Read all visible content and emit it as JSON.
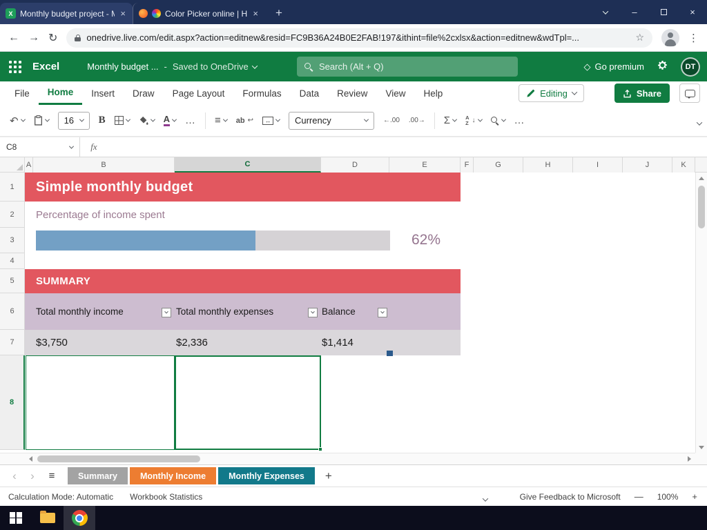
{
  "colors": {
    "excel_green": "#107C41",
    "titlebar_navy": "#1E2F55",
    "banner_red": "#E2575F",
    "progress_blue": "#73A0C5",
    "progress_track": "#D5D2D5",
    "mauve_text": "#9B7A91",
    "table_header_lavender": "#CDBDD0",
    "table_row_gray": "#DAD7DB",
    "tab_summary_gray": "#A3A3A3",
    "tab_income_orange": "#ED7D31",
    "tab_expenses_teal": "#12798A"
  },
  "glyphs": {
    "excel_favicon": "X",
    "close": "×",
    "minimize": "–",
    "new_tab": "+",
    "back": "←",
    "forward": "→",
    "reload": "↻",
    "bookmark_star": "☆",
    "kebab_menu": "⋮",
    "premium_diamond": "◇",
    "undo": "↶",
    "align_lines": "≡",
    "wrap_ab": "ab",
    "wrap_arrow": "↩",
    "merge_arrows": "↔",
    "decimal_decrease": "←.00",
    "decimal_increase": ".00→",
    "autosum": "Σ",
    "sort_a": "A",
    "sort_z": "Z",
    "sort_arrow": "↓",
    "more": "…",
    "font_color_a": "A",
    "sheet_prev": "‹",
    "sheet_next": "›",
    "sheet_menu": "≡",
    "add_sheet": "+",
    "zoom_out": "—",
    "zoom_in": "+"
  },
  "browser": {
    "tabs": [
      {
        "title": "Monthly budget project - Micros"
      },
      {
        "title": "Color Picker online | HEX Col"
      }
    ],
    "url": "onedrive.live.com/edit.aspx?action=editnew&resid=FC9B36A24B0E2FAB!197&ithint=file%2cxlsx&action=editnew&wdTpl=..."
  },
  "header": {
    "app_name": "Excel",
    "doc_title": "Monthly budget ...",
    "title_separator": "-",
    "saved_status": "Saved to OneDrive",
    "search_placeholder": "Search (Alt + Q)",
    "go_premium_label": "Go premium",
    "avatar_initials": "DT"
  },
  "ribbon": {
    "tabs": [
      "File",
      "Home",
      "Insert",
      "Draw",
      "Page Layout",
      "Formulas",
      "Data",
      "Review",
      "View",
      "Help"
    ],
    "active_tab": "Home",
    "editing_label": "Editing",
    "share_label": "Share"
  },
  "toolbar": {
    "font_size": "16",
    "bold_label": "B",
    "number_format": "Currency"
  },
  "formula_bar": {
    "cell_reference": "C8",
    "fx_label": "fx",
    "formula_value": ""
  },
  "sheet": {
    "columns": [
      "A",
      "B",
      "C",
      "D",
      "E",
      "F",
      "G",
      "H",
      "I",
      "J",
      "K"
    ],
    "selected_column": "C",
    "visible_rows": [
      "1",
      "2",
      "3",
      "4",
      "5",
      "6",
      "7",
      "8"
    ],
    "selected_cell": "C8",
    "banner_title": "Simple monthly budget",
    "percent_label": "Percentage of income spent",
    "percent_value": "62%",
    "percent_fill": 62,
    "summary_heading": "SUMMARY",
    "summary_table": {
      "headers": [
        "Total monthly income",
        "Total monthly expenses",
        "Balance"
      ],
      "values": [
        "$3,750",
        "$2,336",
        "$1,414"
      ]
    }
  },
  "sheet_tabs": {
    "items": [
      "Summary",
      "Monthly Income",
      "Monthly Expenses"
    ],
    "active": "Summary"
  },
  "status_bar": {
    "calculation_mode": "Calculation Mode: Automatic",
    "workbook_statistics": "Workbook Statistics",
    "feedback_label": "Give Feedback to Microsoft",
    "zoom_level": "100%"
  }
}
